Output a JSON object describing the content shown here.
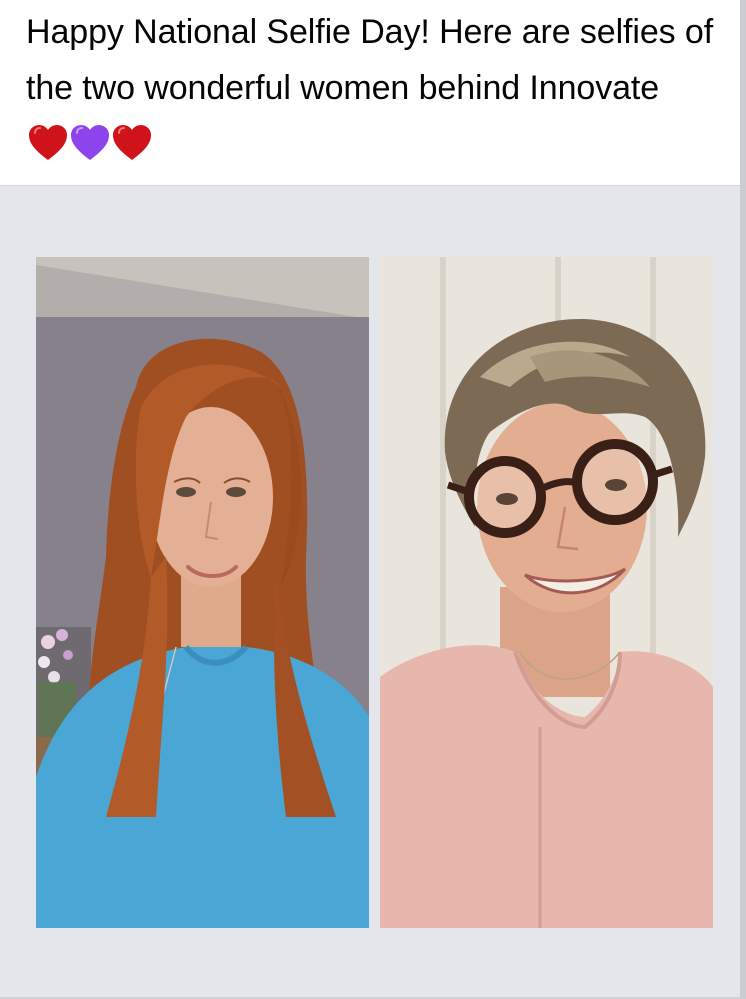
{
  "post": {
    "text": "Happy National Selfie Day! Here are selfies of the two wonderful women behind Innovate",
    "emoji": [
      "red-heart",
      "purple-heart",
      "red-heart"
    ],
    "heart_colors": {
      "red": "#d0121b",
      "purple": "#8e44ec"
    }
  },
  "media": {
    "background": "#e4e6eb",
    "photos": [
      {
        "subject": "woman with long auburn hair wearing a blue top and pendant necklace"
      },
      {
        "subject": "woman with short ash-blonde hair wearing tortoiseshell glasses and a pink blouse"
      }
    ]
  }
}
